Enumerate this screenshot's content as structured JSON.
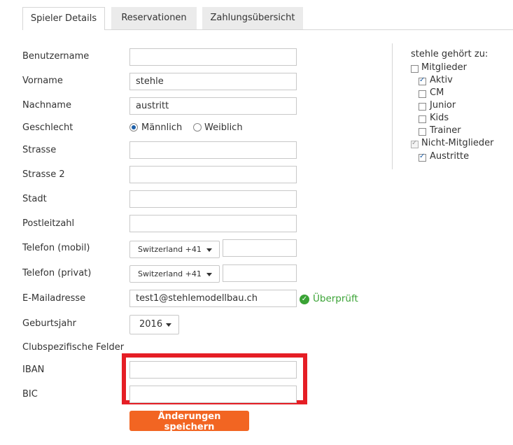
{
  "tabs": [
    "Spieler Details",
    "Reservationen",
    "Zahlungsübersicht"
  ],
  "form": {
    "username_label": "Benutzername",
    "username_value": "",
    "firstname_label": "Vorname",
    "firstname_value": "stehle",
    "lastname_label": "Nachname",
    "lastname_value": "austritt",
    "gender_label": "Geschlecht",
    "gender_male": "Männlich",
    "gender_female": "Weiblich",
    "gender_selected": "Männlich",
    "street_label": "Strasse",
    "street2_label": "Strasse 2",
    "city_label": "Stadt",
    "zip_label": "Postleitzahl",
    "phone_mobile_label": "Telefon (mobil)",
    "phone_mobile_country": "Switzerland +41",
    "phone_private_label": "Telefon (privat)",
    "phone_private_country": "Switzerland +41",
    "email_label": "E-Mailadresse",
    "email_value": "test1@stehlemodellbau.ch",
    "email_status": "Überprüft",
    "birthyear_label": "Geburtsjahr",
    "birthyear_value": "2016",
    "club_fields_label": "Clubspezifische Felder",
    "iban_label": "IBAN",
    "bic_label": "BIC",
    "save_label": "Änderungen speichern"
  },
  "sidebar": {
    "title": "stehle gehört zu:",
    "groups": [
      {
        "label": "Mitglieder",
        "checked": false,
        "indent": 0
      },
      {
        "label": "Aktiv",
        "checked": true,
        "indent": 1
      },
      {
        "label": "CM",
        "checked": false,
        "indent": 1
      },
      {
        "label": "Junior",
        "checked": false,
        "indent": 1
      },
      {
        "label": "Kids",
        "checked": false,
        "indent": 1
      },
      {
        "label": "Trainer",
        "checked": false,
        "indent": 1
      },
      {
        "label": "Nicht-Mitglieder",
        "checked": true,
        "indent": 0
      },
      {
        "label": "Austritte",
        "checked": true,
        "indent": 1
      }
    ]
  },
  "colors": {
    "accent": "#f26522",
    "highlight": "#e51e25",
    "verified": "#3aa335"
  }
}
